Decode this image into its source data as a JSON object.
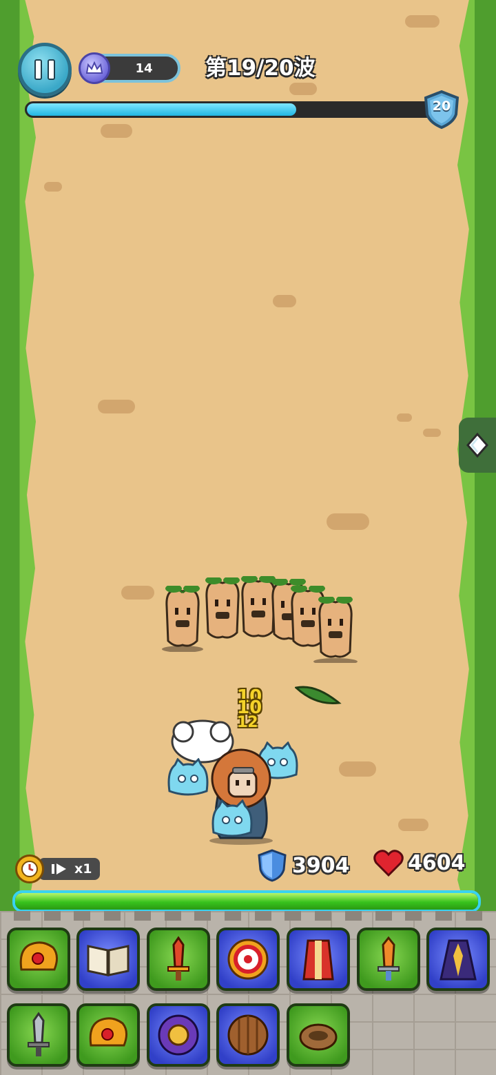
{
  "hud": {
    "crown_count": "14",
    "wave_label": "第19/20波",
    "wave_progress": 0.66,
    "wave_target": "20"
  },
  "battle": {
    "damage_numbers": [
      "10",
      "10",
      "12"
    ]
  },
  "stats": {
    "speed_label": "x1",
    "defense": "3904",
    "health": "4604",
    "health_fraction": 1.0
  },
  "equipment": {
    "row1": [
      {
        "icon": "crown-gem-icon",
        "rarity": "green"
      },
      {
        "icon": "spellbook-icon",
        "rarity": "blue"
      },
      {
        "icon": "red-sword-icon",
        "rarity": "green"
      },
      {
        "icon": "round-shield-icon",
        "rarity": "blue"
      },
      {
        "icon": "robe-armor-icon",
        "rarity": "blue"
      },
      {
        "icon": "orange-sword-icon",
        "rarity": "green"
      },
      {
        "icon": "wizard-cloak-icon",
        "rarity": "blue"
      }
    ],
    "row2": [
      {
        "icon": "steel-sword-icon",
        "rarity": "green"
      },
      {
        "icon": "crown-gem-icon",
        "rarity": "green"
      },
      {
        "icon": "purple-shield-icon",
        "rarity": "blue"
      },
      {
        "icon": "wooden-shield-icon",
        "rarity": "blue"
      },
      {
        "icon": "ring-icon",
        "rarity": "green"
      }
    ]
  },
  "colors": {
    "ground": "#e9c48a",
    "wave_fill": "#22b6e3",
    "hp_fill": "#38c21d",
    "slot_green": "#3f9a1e",
    "slot_blue": "#3140c8"
  }
}
